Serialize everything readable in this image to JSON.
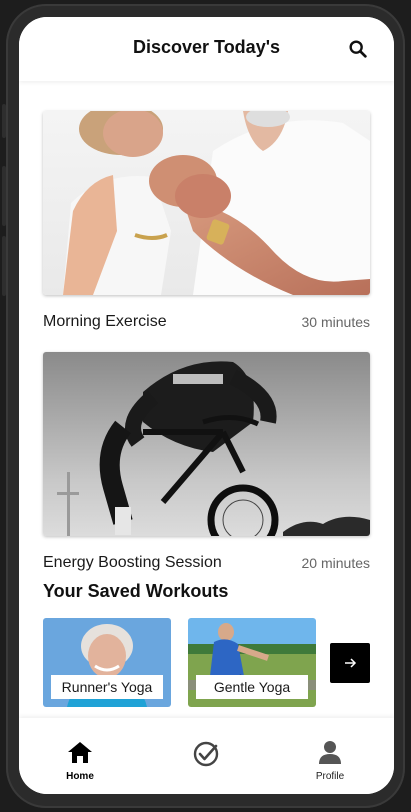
{
  "header": {
    "title": "Discover Today's",
    "search_icon": "search-icon"
  },
  "workouts": [
    {
      "title": "Morning Exercise",
      "duration": "30 minutes",
      "image": "elderly-couple-photo"
    },
    {
      "title": "Energy Boosting Session",
      "duration": "20 minutes",
      "image": "cyclist-photo"
    }
  ],
  "saved": {
    "title": "Your Saved Workouts",
    "items": [
      {
        "label": "Runner's Yoga",
        "image": "smiling-woman-photo"
      },
      {
        "label": "Gentle Yoga",
        "image": "outdoor-stretch-photo"
      }
    ],
    "next_icon": "arrow-right-icon"
  },
  "nav": {
    "items": [
      {
        "label": "Home",
        "icon": "home-icon",
        "active": true
      },
      {
        "label": "",
        "icon": "check-circle-icon",
        "active": false
      },
      {
        "label": "Profile",
        "icon": "person-icon",
        "active": false
      }
    ]
  },
  "colors": {
    "background": "#ffffff",
    "text": "#111111",
    "secondary_text": "#666666",
    "accent": "#000000"
  }
}
